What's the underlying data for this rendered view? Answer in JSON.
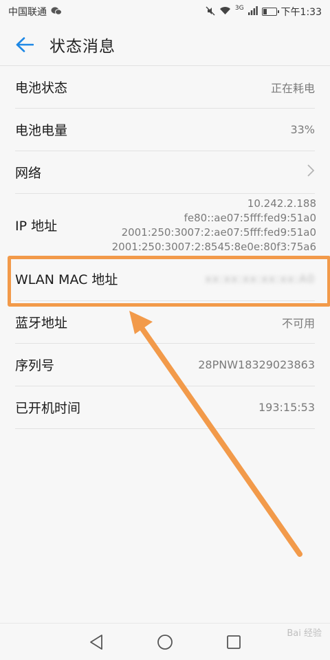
{
  "status_bar": {
    "carrier": "中国联通",
    "network": "3G",
    "time": "下午1:33"
  },
  "header": {
    "title": "状态消息"
  },
  "rows": [
    {
      "label": "电池状态",
      "value": "正在耗电"
    },
    {
      "label": "电池电量",
      "value": "33%"
    },
    {
      "label": "网络",
      "value": ""
    },
    {
      "label": "IP 地址",
      "values": [
        "10.242.2.188",
        "fe80::ae07:5fff:fed9:51a0",
        "2001:250:3007:2:ae07:5fff:fed9:51a0",
        "2001:250:3007:2:8545:8e0e:80f3:75a6"
      ]
    },
    {
      "label": "WLAN MAC 地址",
      "value": "xx:xx:xx:xx:xx:A0"
    },
    {
      "label": "蓝牙地址",
      "value": "不可用"
    },
    {
      "label": "序列号",
      "value": "28PNW18329023863"
    },
    {
      "label": "已开机时间",
      "value": "193:15:53"
    }
  ],
  "watermark": "Bai 经验",
  "colors": {
    "accent": "#1e88e5",
    "highlight": "#f29a4a"
  },
  "icons": [
    "wechat-icon",
    "mute-icon",
    "wifi-icon",
    "signal-icon",
    "battery-icon",
    "back-arrow-icon",
    "chevron-right-icon",
    "nav-back-icon",
    "nav-home-icon",
    "nav-recents-icon"
  ],
  "battery_level": 0.33
}
